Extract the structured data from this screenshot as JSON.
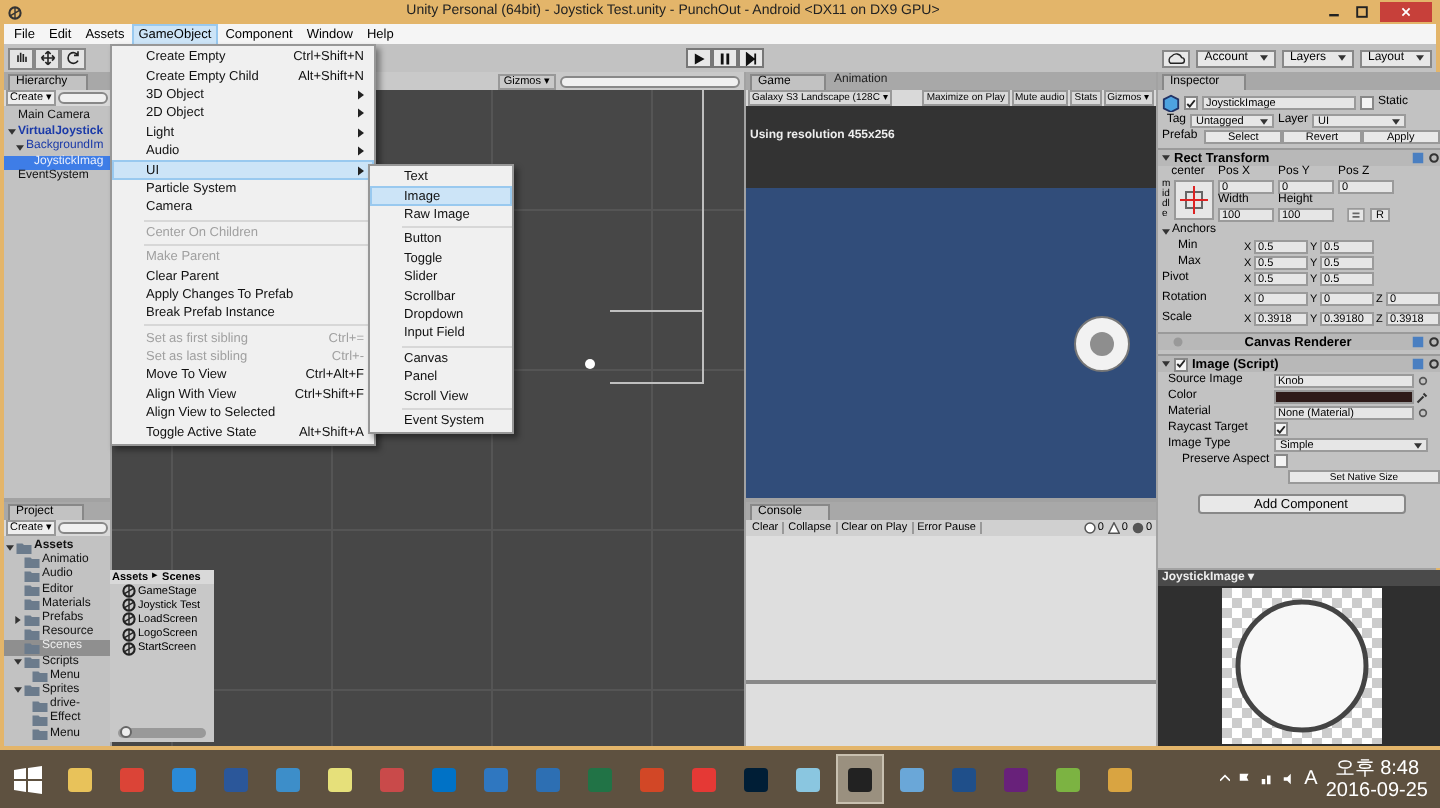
{
  "window": {
    "title": "Unity Personal (64bit) - Joystick Test.unity - PunchOut - Android <DX11 on DX9 GPU>"
  },
  "menu_bar": [
    {
      "label": "File",
      "selected": false
    },
    {
      "label": "Edit",
      "selected": false
    },
    {
      "label": "Assets",
      "selected": false
    },
    {
      "label": "GameObject",
      "selected": true
    },
    {
      "label": "Component",
      "selected": false
    },
    {
      "label": "Window",
      "selected": false
    },
    {
      "label": "Help",
      "selected": false
    }
  ],
  "toolbar": {
    "tools": [
      {
        "kind": "hand",
        "selected": false
      },
      {
        "kind": "move",
        "selected": false
      },
      {
        "kind": "rotate",
        "selected": false
      }
    ],
    "account": "Account",
    "layers": "Layers",
    "layout": "Layout"
  },
  "gameobject_menu": [
    {
      "kind": "item",
      "label": "Create Empty",
      "shortcut": "Ctrl+Shift+N",
      "submenu": false,
      "disabled": false,
      "selected": false
    },
    {
      "kind": "item",
      "label": "Create Empty Child",
      "shortcut": "Alt+Shift+N",
      "submenu": false,
      "disabled": false,
      "selected": false
    },
    {
      "kind": "item",
      "label": "3D Object",
      "submenu": true,
      "disabled": false,
      "selected": false
    },
    {
      "kind": "item",
      "label": "2D Object",
      "submenu": true,
      "disabled": false,
      "selected": false
    },
    {
      "kind": "item",
      "label": "Light",
      "submenu": true,
      "disabled": false,
      "selected": false
    },
    {
      "kind": "item",
      "label": "Audio",
      "submenu": true,
      "disabled": false,
      "selected": false
    },
    {
      "kind": "item",
      "label": "UI",
      "submenu": true,
      "disabled": false,
      "selected": true
    },
    {
      "kind": "item",
      "label": "Particle System",
      "submenu": false,
      "disabled": false,
      "selected": false
    },
    {
      "kind": "item",
      "label": "Camera",
      "submenu": false,
      "disabled": false,
      "selected": false
    },
    {
      "kind": "separator"
    },
    {
      "kind": "item",
      "label": "Center On Children",
      "submenu": false,
      "disabled": true,
      "selected": false
    },
    {
      "kind": "separator"
    },
    {
      "kind": "item",
      "label": "Make Parent",
      "submenu": false,
      "disabled": true,
      "selected": false
    },
    {
      "kind": "item",
      "label": "Clear Parent",
      "submenu": false,
      "disabled": false,
      "selected": false
    },
    {
      "kind": "item",
      "label": "Apply Changes To Prefab",
      "submenu": false,
      "disabled": false,
      "selected": false
    },
    {
      "kind": "item",
      "label": "Break Prefab Instance",
      "submenu": false,
      "disabled": false,
      "selected": false
    },
    {
      "kind": "separator"
    },
    {
      "kind": "item",
      "label": "Set as first sibling",
      "shortcut": "Ctrl+=",
      "submenu": false,
      "disabled": true,
      "selected": false
    },
    {
      "kind": "item",
      "label": "Set as last sibling",
      "shortcut": "Ctrl+-",
      "submenu": false,
      "disabled": true,
      "selected": false
    },
    {
      "kind": "item",
      "label": "Move To View",
      "shortcut": "Ctrl+Alt+F",
      "submenu": false,
      "disabled": false,
      "selected": false
    },
    {
      "kind": "item",
      "label": "Align With View",
      "shortcut": "Ctrl+Shift+F",
      "submenu": false,
      "disabled": false,
      "selected": false
    },
    {
      "kind": "item",
      "label": "Align View to Selected",
      "submenu": false,
      "disabled": false,
      "selected": false
    },
    {
      "kind": "item",
      "label": "Toggle Active State",
      "shortcut": "Alt+Shift+A",
      "submenu": false,
      "disabled": false,
      "selected": false
    }
  ],
  "ui_submenu": [
    {
      "kind": "item",
      "label": "Text",
      "selected": false
    },
    {
      "kind": "item",
      "label": "Image",
      "selected": true
    },
    {
      "kind": "item",
      "label": "Raw Image",
      "selected": false
    },
    {
      "kind": "separator"
    },
    {
      "kind": "item",
      "label": "Button",
      "selected": false
    },
    {
      "kind": "item",
      "label": "Toggle",
      "selected": false
    },
    {
      "kind": "item",
      "label": "Slider",
      "selected": false
    },
    {
      "kind": "item",
      "label": "Scrollbar",
      "selected": false
    },
    {
      "kind": "item",
      "label": "Dropdown",
      "selected": false
    },
    {
      "kind": "item",
      "label": "Input Field",
      "selected": false
    },
    {
      "kind": "separator"
    },
    {
      "kind": "item",
      "label": "Canvas",
      "selected": false
    },
    {
      "kind": "item",
      "label": "Panel",
      "selected": false
    },
    {
      "kind": "item",
      "label": "Scroll View",
      "selected": false
    },
    {
      "kind": "separator"
    },
    {
      "kind": "item",
      "label": "Event System",
      "selected": false
    }
  ],
  "hierarchy": {
    "tab": "Hierarchy",
    "create": "Create ▾",
    "items": [
      {
        "label": "Main Camera",
        "prefab": false,
        "selected": false
      },
      {
        "label": "VirtualJoystick",
        "prefab": true,
        "selected": false,
        "expanded": true,
        "children": [
          {
            "label": "BackgroundIm",
            "prefab": true,
            "selected": false,
            "expanded": true,
            "children": [
              {
                "label": "JoystickImag",
                "prefab": true,
                "selected": true
              }
            ]
          }
        ]
      },
      {
        "label": "EventSystem",
        "prefab": false,
        "selected": false
      }
    ]
  },
  "project": {
    "tab": "Project",
    "create": "Create ▾",
    "tree": [
      {
        "label": "Assets",
        "selected": false,
        "expanded": true,
        "children": [
          {
            "label": "Animatio",
            "selected": false
          },
          {
            "label": "Audio",
            "selected": false
          },
          {
            "label": "Editor",
            "selected": false
          },
          {
            "label": "Materials",
            "selected": false
          },
          {
            "label": "Prefabs",
            "selected": false,
            "expanded": false
          },
          {
            "label": "Resource",
            "selected": false
          },
          {
            "label": "Scenes",
            "selected": true
          },
          {
            "label": "Scripts",
            "selected": false,
            "expanded": true,
            "children": [
              {
                "label": "Menu",
                "selected": false
              }
            ]
          },
          {
            "label": "Sprites",
            "selected": false,
            "expanded": true,
            "children": [
              {
                "label": "drive-",
                "selected": false
              },
              {
                "label": "Effect",
                "selected": false
              },
              {
                "label": "Menu",
                "selected": false
              }
            ]
          }
        ]
      }
    ],
    "breadcrumb": [
      "Assets",
      "Scenes"
    ],
    "breadcrumb_separator": "▸",
    "files": [
      "GameStage",
      "Joystick Test",
      "LoadScreen",
      "LogoScreen",
      "StartScreen"
    ],
    "zoom_slider": {
      "level": 0.1
    }
  },
  "scene_view": {
    "gizmos": "Gizmos ▾"
  },
  "game_view": {
    "tabs": [
      {
        "label": "Game",
        "selected": true
      },
      {
        "label": "Animation",
        "selected": false
      }
    ],
    "aspect": "Galaxy S3 Landscape (128C ▾",
    "buttons": [
      "Maximize on Play",
      "Mute audio",
      "Stats",
      "Gizmos ▾"
    ],
    "resolution": "Using resolution 455x256"
  },
  "console": {
    "tab": "Console",
    "buttons": [
      "Clear",
      "Collapse",
      "Clear on Play",
      "Error Pause"
    ],
    "counts": [
      {
        "kind": "info",
        "count": "0"
      },
      {
        "kind": "warning",
        "count": "0"
      },
      {
        "kind": "error",
        "count": "0"
      }
    ]
  },
  "inspector": {
    "tab": "Inspector",
    "name": "JoystickImage",
    "active": true,
    "static_label": "Static",
    "static": false,
    "tag_label": "Tag",
    "tag": "Untagged",
    "layer_label": "Layer",
    "layer": "UI",
    "prefab_label": "Prefab",
    "prefab_buttons": [
      "Select",
      "Revert",
      "Apply"
    ],
    "rect_transform": {
      "title": "Rect Transform",
      "anchor_h": "center",
      "anchor_v": "middle",
      "pos": [
        {
          "label": "Pos X",
          "value": "0"
        },
        {
          "label": "Pos Y",
          "value": "0"
        },
        {
          "label": "Pos Z",
          "value": "0"
        }
      ],
      "size": [
        {
          "label": "Width",
          "value": "100"
        },
        {
          "label": "Height",
          "value": "100"
        }
      ],
      "r_button": "R",
      "anchors_label": "Anchors",
      "rows": [
        {
          "label": "Min",
          "indent": true,
          "values": [
            [
              "X",
              "0.5"
            ],
            [
              "Y",
              "0.5"
            ]
          ]
        },
        {
          "label": "Max",
          "indent": true,
          "values": [
            [
              "X",
              "0.5"
            ],
            [
              "Y",
              "0.5"
            ]
          ]
        },
        {
          "label": "Pivot",
          "indent": false,
          "values": [
            [
              "X",
              "0.5"
            ],
            [
              "Y",
              "0.5"
            ]
          ]
        },
        {
          "label": "Rotation",
          "indent": false,
          "values": [
            [
              "X",
              "0"
            ],
            [
              "Y",
              "0"
            ],
            [
              "Z",
              "0"
            ]
          ]
        },
        {
          "label": "Scale",
          "indent": false,
          "values": [
            [
              "X",
              "0.3918"
            ],
            [
              "Y",
              "0.39180"
            ],
            [
              "Z",
              "0.3918"
            ]
          ]
        }
      ]
    },
    "canvas_renderer": "Canvas Renderer",
    "image": {
      "title": "Image (Script)",
      "enabled": true,
      "source_label": "Source Image",
      "source": "Knob",
      "color_label": "Color",
      "color": "#2e1a18",
      "material_label": "Material",
      "material": "None (Material)",
      "raycast_label": "Raycast Target",
      "raycast": true,
      "type_label": "Image Type",
      "type": "Simple",
      "preserve_label": "Preserve Aspect",
      "preserve": false,
      "native_button": "Set Native Size"
    },
    "add_component": "Add Component"
  },
  "preview": {
    "title": "JoystickImage ▾"
  },
  "taskbar": {
    "apps": [
      {
        "kind": "folder",
        "selected": false
      },
      {
        "kind": "chrome",
        "selected": false
      },
      {
        "kind": "ie",
        "selected": false
      },
      {
        "kind": "word",
        "selected": false
      },
      {
        "kind": "ws",
        "selected": false
      },
      {
        "kind": "notes",
        "selected": false
      },
      {
        "kind": "tool",
        "selected": false
      },
      {
        "kind": "outlook",
        "selected": false
      },
      {
        "kind": "remote",
        "selected": false
      },
      {
        "kind": "qb",
        "selected": false
      },
      {
        "kind": "excel",
        "selected": false
      },
      {
        "kind": "powerpoint",
        "selected": false
      },
      {
        "kind": "record",
        "selected": false
      },
      {
        "kind": "photoshop",
        "selected": false
      },
      {
        "kind": "glass",
        "selected": false
      },
      {
        "kind": "unity",
        "selected": true
      },
      {
        "kind": "calculator",
        "selected": false
      },
      {
        "kind": "globe",
        "selected": false
      },
      {
        "kind": "vs",
        "selected": false
      },
      {
        "kind": "chart",
        "selected": false
      },
      {
        "kind": "paint",
        "selected": false
      }
    ],
    "ime": "A",
    "time": "오후 8:48",
    "date": "2016-09-25"
  }
}
